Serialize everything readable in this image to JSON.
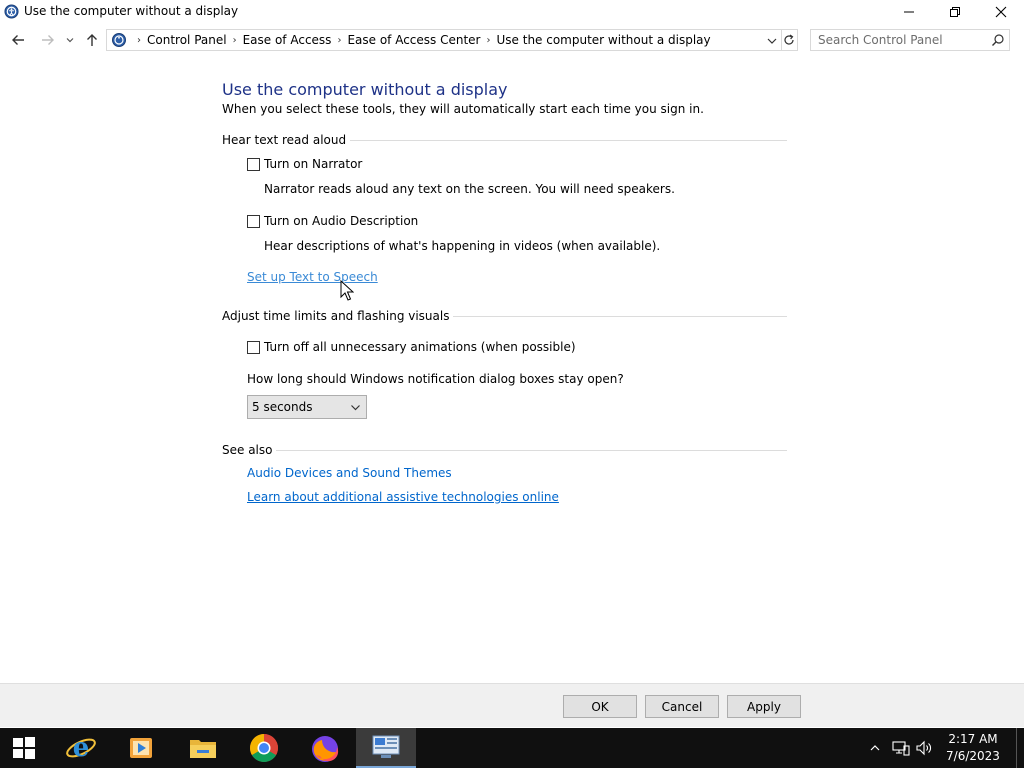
{
  "window": {
    "title": "Use the computer without a display"
  },
  "address": {
    "breadcrumbs": [
      "Control Panel",
      "Ease of Access",
      "Ease of Access Center",
      "Use the computer without a display"
    ],
    "search_placeholder": "Search Control Panel"
  },
  "main": {
    "title": "Use the computer without a display",
    "subtitle": "When you select these tools, they will automatically start each time you sign in.",
    "sections": {
      "hear_text": {
        "heading": "Hear text read aloud",
        "narrator_label": "Turn on Narrator",
        "narrator_checked": false,
        "narrator_desc": "Narrator reads aloud any text on the screen. You will need speakers.",
        "audio_desc_label": "Turn on Audio Description",
        "audio_desc_checked": false,
        "audio_desc_desc": "Hear descriptions of what's happening in videos (when available).",
        "tts_link": "Set up Text to Speech"
      },
      "time_limits": {
        "heading": "Adjust time limits and flashing visuals",
        "animations_label": "Turn off all unnecessary animations (when possible)",
        "animations_checked": false,
        "notification_question": "How long should Windows notification dialog boxes stay open?",
        "notification_value": "5 seconds"
      },
      "see_also": {
        "heading": "See also",
        "link1": "Audio Devices and Sound Themes",
        "link2": "Learn about additional assistive technologies online"
      }
    }
  },
  "buttons": {
    "ok": "OK",
    "cancel": "Cancel",
    "apply": "Apply"
  },
  "taskbar": {
    "time": "2:17 AM",
    "date": "7/6/2023",
    "apps": [
      "internet-explorer-icon",
      "media-player-icon",
      "file-explorer-icon",
      "chrome-icon",
      "firefox-icon",
      "control-panel-icon"
    ]
  },
  "colors": {
    "title_blue": "#1e3287",
    "link_blue": "#0066cc",
    "taskbar": "#101010"
  }
}
